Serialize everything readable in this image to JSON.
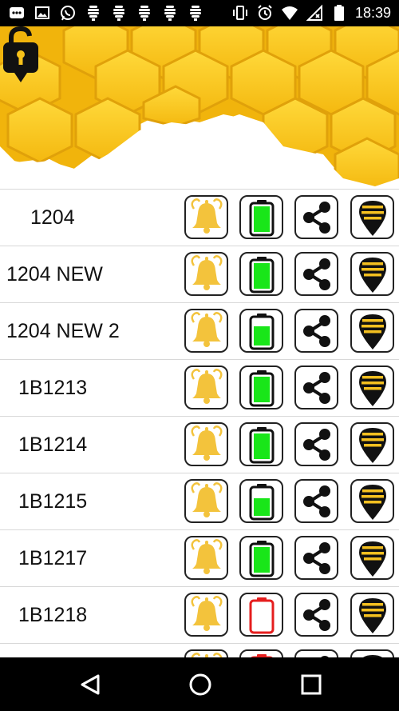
{
  "status_bar": {
    "time": "18:39",
    "left_icons": [
      "chat-icon",
      "image-icon",
      "whatsapp-icon",
      "beehive-icon",
      "beehive-icon",
      "beehive-icon",
      "beehive-icon",
      "beehive-icon"
    ],
    "right_icons": [
      "vibrate-icon",
      "alarm-icon",
      "wifi-icon",
      "no-sim-icon",
      "battery-icon"
    ]
  },
  "header": {
    "logo": "lock-location-pin-icon",
    "accent_color": "#F7C21A"
  },
  "devices": [
    {
      "name": "1204",
      "battery": 1.0,
      "battery_color": "#19E619"
    },
    {
      "name": "1204 NEW",
      "battery": 1.0,
      "battery_color": "#19E619"
    },
    {
      "name": "1204 NEW 2",
      "battery": 0.75,
      "battery_color": "#19E619"
    },
    {
      "name": "1B1213",
      "battery": 1.0,
      "battery_color": "#19E619"
    },
    {
      "name": "1B1214",
      "battery": 1.0,
      "battery_color": "#19E619"
    },
    {
      "name": "1B1215",
      "battery": 0.7,
      "battery_color": "#19E619"
    },
    {
      "name": "1B1217",
      "battery": 1.0,
      "battery_color": "#19E619"
    },
    {
      "name": "1B1218",
      "battery": 0.0,
      "battery_color": "#E51E1E"
    },
    {
      "name": "",
      "battery": 0.0,
      "battery_color": "#E51E1E"
    }
  ],
  "row_icons": [
    "bell-alarm-icon",
    "battery-icon",
    "share-icon",
    "map-pin-icon"
  ],
  "nav": [
    "back-icon",
    "home-icon",
    "recents-icon"
  ]
}
